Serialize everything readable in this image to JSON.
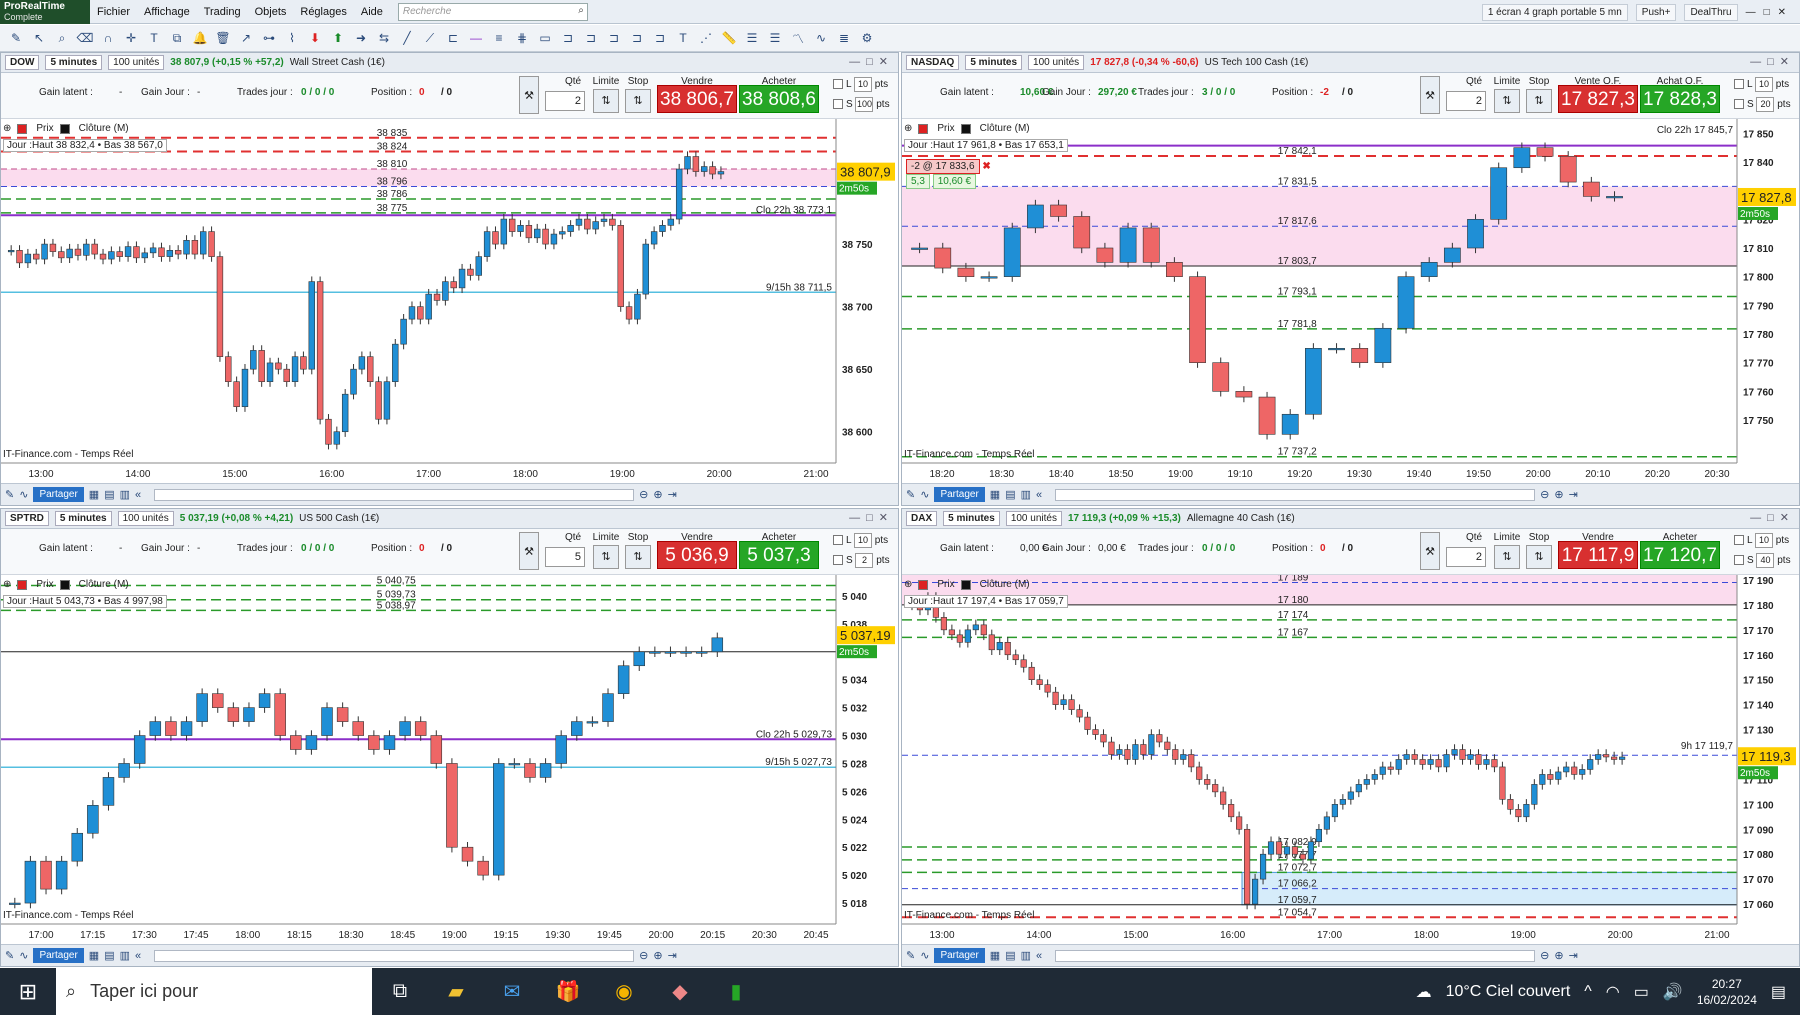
{
  "app": {
    "logo_line1": "ProRealTime",
    "logo_line2": "Complete",
    "menu": [
      "Fichier",
      "Affichage",
      "Trading",
      "Objets",
      "Réglages",
      "Aide"
    ],
    "search_placeholder": "Recherche",
    "layout": "1 écran 4 graph portable 5 mn",
    "push": "Push+",
    "dealthru": "DealThru"
  },
  "colors": {
    "bull": "#1f8fd6",
    "bear": "#ee6666",
    "sell": "#d83030",
    "buy": "#26a626",
    "zone": "#fbdcee",
    "zone_blue": "#d6ecfa",
    "purple": "#8b2fc9",
    "cyan": "#55bfe0",
    "red_dash": "#e03030",
    "green_dash": "#2a9a2a"
  },
  "common": {
    "gain_latent": "Gain latent :",
    "gain_jour": "Gain Jour :",
    "trades_jour": "Trades jour :",
    "position": "Position :",
    "qte": "Qté",
    "limite": "Limite",
    "stop": "Stop",
    "vendre": "Vendre",
    "acheter": "Acheter",
    "prix": "Prix",
    "cloture": "Clôture (M)",
    "source": "IT-Finance.com - Temps Réel",
    "partager": "Partager",
    "l": "L",
    "s": "S",
    "pts": "pts",
    "clo_m": "Clo M"
  },
  "panels": [
    {
      "id": "dow",
      "symbol": "DOW",
      "tf": "5 minutes",
      "units": "100 unités",
      "quote": "38 807,9 (+0,15 % +57,2)",
      "quote_dir": "pos",
      "name": "Wall Street Cash (1€)",
      "gain_latent_val": "-",
      "gain_jour_val": "-",
      "trades_val": "0 / 0 / 0",
      "position_val": "0",
      "pos_after": "/ 0",
      "qty": "2",
      "sell": "38 806,7",
      "buy": "38 808,6",
      "l_pts": "10",
      "s_pts": "100",
      "jour": "Jour :Haut 38 832,4 • Bas 38 567,0",
      "cursor_price": "38 807,9",
      "timer": "2m50s",
      "chart_data": {
        "type": "candlestick",
        "ylim": [
          38575,
          38850
        ],
        "yticks": [
          "38 600",
          "38 650",
          "38 700",
          "38 750"
        ],
        "xlabels": [
          "13:00",
          "14:00",
          "15:00",
          "16:00",
          "17:00",
          "18:00",
          "19:00",
          "20:00",
          "21:00"
        ],
        "levels": [
          {
            "v": 38835,
            "label": "38 835",
            "style": "red"
          },
          {
            "v": 38824,
            "label": "38 824",
            "style": "red"
          },
          {
            "v": 38810,
            "label": "38 810",
            "style": "pink"
          },
          {
            "v": 38796,
            "label": "38 796",
            "style": "blue"
          },
          {
            "v": 38786,
            "label": "38 786",
            "style": "green"
          },
          {
            "v": 38775,
            "label": "38 775",
            "style": "green"
          },
          {
            "v": 38773.1,
            "label": "Clo 22h 38 773,1",
            "style": "purple"
          },
          {
            "v": 38711.5,
            "label": "9/15h 38 711,5",
            "style": "cyan"
          }
        ],
        "zone": [
          38796,
          38810
        ],
        "closes": [
          38745,
          38735,
          38742,
          38738,
          38750,
          38744,
          38739,
          38746,
          38741,
          38750,
          38742,
          38738,
          38744,
          38740,
          38748,
          38739,
          38743,
          38747,
          38740,
          38745,
          38742,
          38753,
          38742,
          38760,
          38740,
          38660,
          38640,
          38620,
          38650,
          38665,
          38640,
          38655,
          38650,
          38640,
          38660,
          38650,
          38720,
          38610,
          38590,
          38600,
          38630,
          38650,
          38660,
          38640,
          38610,
          38640,
          38670,
          38690,
          38700,
          38690,
          38710,
          38705,
          38720,
          38715,
          38730,
          38725,
          38740,
          38760,
          38750,
          38770,
          38760,
          38765,
          38755,
          38762,
          38750,
          38758,
          38760,
          38765,
          38770,
          38762,
          38768,
          38770,
          38765,
          38700,
          38690,
          38710,
          38750,
          38760,
          38765,
          38770,
          38810,
          38820,
          38808,
          38812,
          38806,
          38808
        ]
      }
    },
    {
      "id": "nasdaq",
      "symbol": "NASDAQ",
      "tf": "5 minutes",
      "units": "100 unités",
      "quote": "17 827,8 (-0,34 % -60,6)",
      "quote_dir": "neg",
      "name": "US Tech 100 Cash (1€)",
      "gain_latent_val": "10,60 €",
      "gain_jour_val": "297,20 €",
      "trades_val": "3 / 0 / 0",
      "position_val": "-2",
      "pos_after": "/ 0",
      "qty": "2",
      "sell": "17 827,3",
      "buy": "17 828,3",
      "vente_label": "Vente O.F.",
      "achat_label": "Achat O.F.",
      "l_pts": "10",
      "s_pts": "20",
      "jour": "Jour :Haut 17 961,8 • Bas 17 653,1",
      "order_tag": "-2 @ 17 833,6",
      "order_pts": "5,3",
      "order_eur": "10,60 €",
      "clo22": "Clo 22h 17 845,7",
      "cursor_price": "17 827,8",
      "timer": "2m50s",
      "chart_data": {
        "type": "candlestick",
        "ylim": [
          17735,
          17855
        ],
        "yticks": [
          "17 750",
          "17 760",
          "17 770",
          "17 780",
          "17 790",
          "17 800",
          "17 810",
          "17 820",
          "17 840",
          "17 850"
        ],
        "xlabels": [
          "18:20",
          "18:30",
          "18:40",
          "18:50",
          "19:00",
          "19:10",
          "19:20",
          "19:30",
          "19:40",
          "19:50",
          "20:00",
          "20:10",
          "20:20",
          "20:30"
        ],
        "levels": [
          {
            "v": 17845.7,
            "label": "",
            "style": "purple"
          },
          {
            "v": 17842.1,
            "label": "17 842,1",
            "style": "red"
          },
          {
            "v": 17831.5,
            "label": "17 831,5",
            "style": "blue"
          },
          {
            "v": 17817.6,
            "label": "17 817,6",
            "style": "blue"
          },
          {
            "v": 17803.7,
            "label": "17 803,7",
            "style": "black"
          },
          {
            "v": 17793.1,
            "label": "17 793,1",
            "style": "green"
          },
          {
            "v": 17781.8,
            "label": "17 781,8",
            "style": "green"
          },
          {
            "v": 17737.2,
            "label": "17 737,2",
            "style": "green"
          }
        ],
        "zone": [
          17803.7,
          17831.5
        ],
        "closes": [
          17810,
          17803,
          17800,
          17800,
          17817,
          17825,
          17821,
          17810,
          17805,
          17817,
          17805,
          17800,
          17770,
          17760,
          17758,
          17745,
          17752,
          17775,
          17775,
          17770,
          17782,
          17800,
          17805,
          17810,
          17820,
          17838,
          17845,
          17842,
          17833,
          17828,
          17828
        ]
      }
    },
    {
      "id": "sp500",
      "symbol": "SPTRD",
      "tf": "5 minutes",
      "units": "100 unités",
      "quote": "5 037,19 (+0,08 % +4,21)",
      "quote_dir": "pos",
      "name": "US 500 Cash (1€)",
      "gain_latent_val": "-",
      "gain_jour_val": "-",
      "trades_val": "0 / 0 / 0",
      "position_val": "0",
      "pos_after": "/ 0",
      "qty": "5",
      "sell": "5 036,9",
      "buy": "5 037,3",
      "l_pts": "10",
      "s_pts": "2",
      "jour": "Jour :Haut 5 043,73 • Bas 4 997,98",
      "cursor_price": "5 037,19",
      "timer": "2m50s",
      "chart_data": {
        "type": "candlestick",
        "ylim": [
          5016.5,
          5041.5
        ],
        "yticks": [
          "5 018",
          "5 020",
          "5 022",
          "5 024",
          "5 026",
          "5 028",
          "5 030",
          "5 032",
          "5 034",
          "5 036",
          "5 038",
          "5 040"
        ],
        "xlabels": [
          "17:00",
          "17:15",
          "17:30",
          "17:45",
          "18:00",
          "18:15",
          "18:30",
          "18:45",
          "19:00",
          "19:15",
          "19:30",
          "19:45",
          "20:00",
          "20:15",
          "20:30",
          "20:45"
        ],
        "levels": [
          {
            "v": 5040.75,
            "label": "5 040,75",
            "style": "green"
          },
          {
            "v": 5039.73,
            "label": "5 039,73",
            "style": "green"
          },
          {
            "v": 5038.97,
            "label": "5 038,97",
            "style": "green"
          },
          {
            "v": 5036,
            "label": "",
            "style": "black"
          },
          {
            "v": 5029.73,
            "label": "Clo 22h 5 029,73",
            "style": "purple"
          },
          {
            "v": 5027.73,
            "label": "9/15h 5 027,73",
            "style": "cyan"
          }
        ],
        "zone": null,
        "closes": [
          5018,
          5021,
          5019,
          5021,
          5023,
          5025,
          5027,
          5028,
          5030,
          5031,
          5030,
          5031,
          5033,
          5032,
          5031,
          5032,
          5033,
          5030,
          5029,
          5030,
          5032,
          5031,
          5030,
          5029,
          5030,
          5031,
          5030,
          5028,
          5022,
          5021,
          5020,
          5028,
          5028,
          5027,
          5028,
          5030,
          5031,
          5031,
          5033,
          5035,
          5036,
          5036,
          5036,
          5036,
          5036,
          5037
        ]
      }
    },
    {
      "id": "dax",
      "symbol": "DAX",
      "tf": "5 minutes",
      "units": "100 unités",
      "quote": "17 119,3 (+0,09 % +15,3)",
      "quote_dir": "pos",
      "name": "Allemagne 40 Cash (1€)",
      "gain_latent_val": "0,00 €",
      "gain_jour_val": "0,00 €",
      "trades_val": "0 / 0 / 0",
      "position_val": "0",
      "pos_after": "/ 0",
      "qty": "2",
      "sell": "17 117,9",
      "buy": "17 120,7",
      "l_pts": "10",
      "s_pts": "40",
      "jour": "Jour :Haut 17 197,4 • Bas 17 059,7",
      "cursor_price": "17 119,3",
      "timer": "2m50s",
      "clo_9h": "9h 17 119,7",
      "chart_data": {
        "type": "candlestick",
        "ylim": [
          17052,
          17192
        ],
        "yticks": [
          "17 060",
          "17 070",
          "17 080",
          "17 090",
          "17 100",
          "17 110",
          "17 120",
          "17 130",
          "17 140",
          "17 150",
          "17 160",
          "17 170",
          "17 180",
          "17 190"
        ],
        "xlabels": [
          "13:00",
          "14:00",
          "15:00",
          "16:00",
          "17:00",
          "18:00",
          "19:00",
          "20:00",
          "21:00"
        ],
        "levels": [
          {
            "v": 17189,
            "label": "17 189",
            "style": "blue"
          },
          {
            "v": 17180,
            "label": "17 180",
            "style": "black"
          },
          {
            "v": 17174,
            "label": "17 174",
            "style": "green"
          },
          {
            "v": 17167,
            "label": "17 167",
            "style": "green"
          },
          {
            "v": 17119.7,
            "label": "",
            "style": "blue"
          },
          {
            "v": 17082.9,
            "label": "17 082,9",
            "style": "green"
          },
          {
            "v": 17077.7,
            "label": "17 077,7",
            "style": "green"
          },
          {
            "v": 17072.7,
            "label": "17 072,7",
            "style": "green"
          },
          {
            "v": 17066.2,
            "label": "17 066,2",
            "style": "blue"
          },
          {
            "v": 17059.7,
            "label": "17 059,7",
            "style": "black"
          },
          {
            "v": 17054.7,
            "label": "17 054,7",
            "style": "red"
          }
        ],
        "zone": [
          17180,
          17192
        ],
        "zone2": [
          17059.7,
          17072.7
        ],
        "closes": [
          17180,
          17178,
          17183,
          17175,
          17170,
          17168,
          17165,
          17170,
          17172,
          17168,
          17162,
          17165,
          17160,
          17158,
          17155,
          17150,
          17148,
          17145,
          17140,
          17142,
          17138,
          17135,
          17130,
          17128,
          17125,
          17120,
          17122,
          17118,
          17124,
          17120,
          17128,
          17125,
          17122,
          17118,
          17120,
          17115,
          17110,
          17108,
          17105,
          17100,
          17095,
          17090,
          17060,
          17070,
          17080,
          17085,
          17080,
          17083,
          17080,
          17078,
          17085,
          17090,
          17095,
          17100,
          17102,
          17105,
          17108,
          17110,
          17112,
          17115,
          17114,
          17118,
          17120,
          17118,
          17116,
          17118,
          17115,
          17120,
          17122,
          17118,
          17120,
          17116,
          17118,
          17115,
          17102,
          17098,
          17095,
          17100,
          17108,
          17112,
          17110,
          17113,
          17115,
          17112,
          17114,
          17118,
          17120,
          17119,
          17118,
          17119
        ]
      }
    }
  ],
  "taskbar": {
    "search": "Taper ici pour",
    "weather": "10°C  Ciel couvert",
    "time": "20:27",
    "date": "16/02/2024"
  }
}
